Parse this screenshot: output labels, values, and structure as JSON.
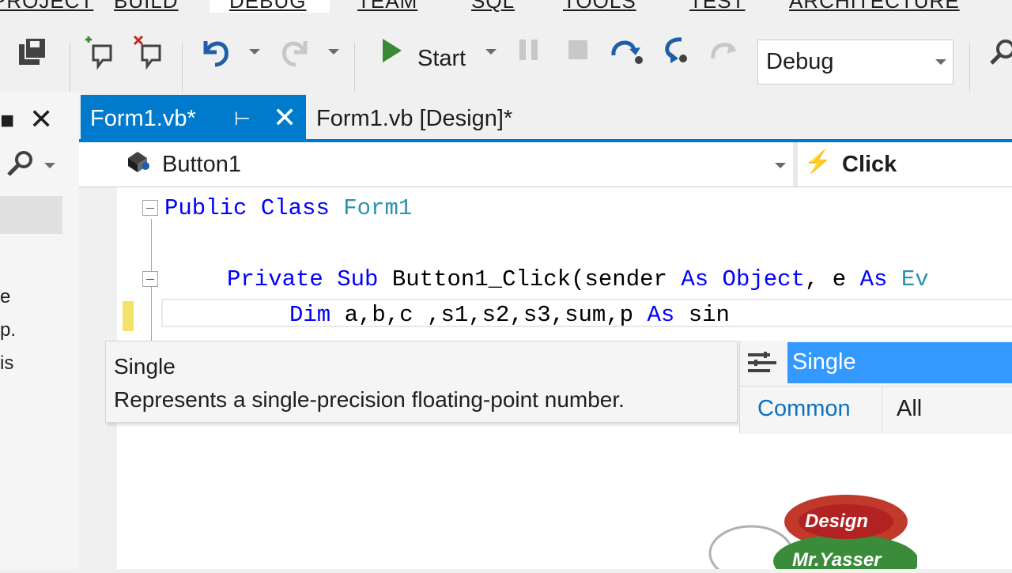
{
  "menu": {
    "items": [
      "PROJECT",
      "BUILD",
      "DEBUG",
      "TEAM",
      "SQL",
      "TOOLS",
      "TEST",
      "ARCHITECTURE"
    ]
  },
  "toolbar": {
    "start_label": "Start",
    "configuration": "Debug"
  },
  "left_panel": {
    "cut_lines": [
      "e",
      "p.",
      "is"
    ]
  },
  "tabs": [
    {
      "label": "Form1.vb*",
      "active": true
    },
    {
      "label": "Form1.vb [Design]*",
      "active": false
    }
  ],
  "navbar": {
    "class_name": "Button1",
    "event_name": "Click"
  },
  "code": {
    "line1": {
      "kw1": "Public",
      "kw2": "Class",
      "name": "Form1"
    },
    "line3": {
      "kw1": "Private",
      "kw2": "Sub",
      "sig": "Button1_Click(sender",
      "kw3": "As",
      "type": "Object",
      "mid": ", e",
      "kw4": "As",
      "tail": "Ev"
    },
    "line4": {
      "kw1": "Dim",
      "vars": "a,b,c ,s1,s2,s3,sum,p",
      "kw2": "As",
      "typed": "sin"
    }
  },
  "tooltip": {
    "title": "Single",
    "description": "Represents a single-precision floating-point number."
  },
  "completion": {
    "selected_item": "Single",
    "tabs": [
      "Common",
      "All"
    ]
  },
  "watermark": {
    "line1": "Design",
    "line2": "Mr.Yasser"
  },
  "colors": {
    "accent": "#007acc",
    "keyword": "#0000ff",
    "type": "#2b91af",
    "selection": "#3399ff"
  }
}
